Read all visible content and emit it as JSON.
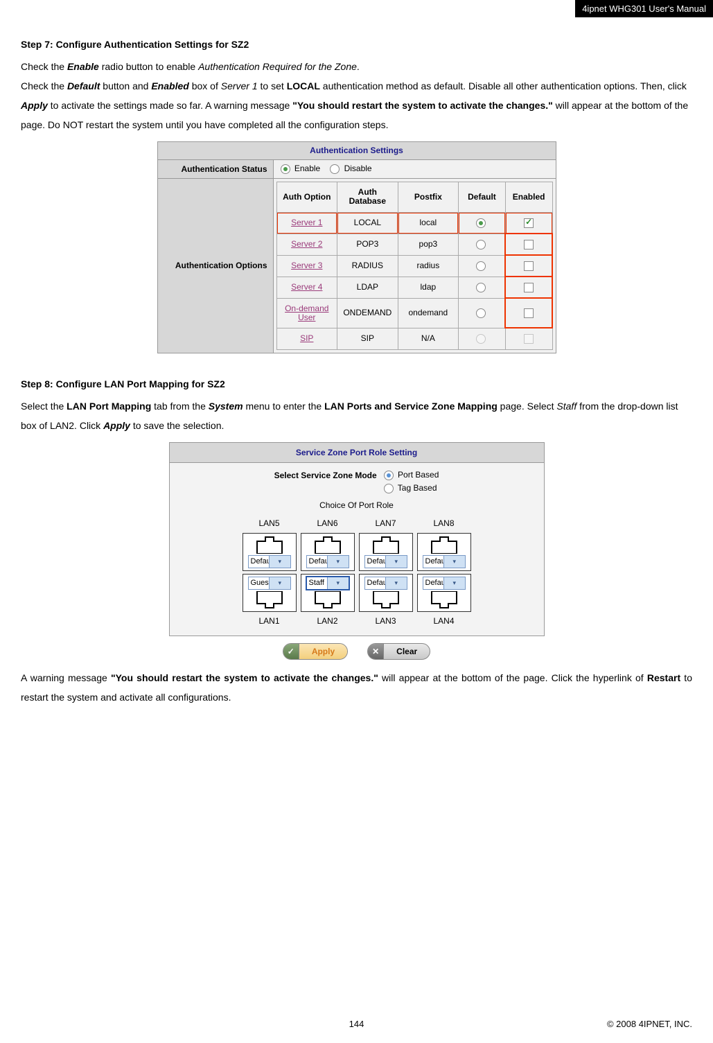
{
  "header": {
    "doc_title": "4ipnet WHG301 User's Manual"
  },
  "step7": {
    "title": "Step 7: Configure Authentication Settings for SZ2",
    "para": {
      "p1a": "Check the ",
      "enable": "Enable",
      "p1b": " radio button to enable ",
      "authreq": "Authentication Required for the Zone",
      "p1c": ".",
      "p2a": "Check the ",
      "default": "Default",
      "p2b": " button and ",
      "enabled": "Enabled",
      "p2c": " box of ",
      "server1": "Server 1",
      "p2d": " to set ",
      "local": "LOCAL",
      "p2e": " authentication method as default. Disable all other authentication options. Then, click ",
      "apply": "Apply",
      "p2f": " to activate the settings made so far. A warning message ",
      "warn": "\"You should restart the system to activate the changes.\"",
      "p2g": " will appear at the bottom of the page. Do NOT restart the system until you have completed all the configuration steps."
    }
  },
  "auth_settings": {
    "title": "Authentication Settings",
    "row_status_label": "Authentication Status",
    "enable_label": "Enable",
    "disable_label": "Disable",
    "row_options_label": "Authentication Options",
    "cols": {
      "c1": "Auth Option",
      "c2": "Auth Database",
      "c3": "Postfix",
      "c4": "Default",
      "c5": "Enabled"
    },
    "rows": [
      {
        "opt": "Server 1",
        "db": "LOCAL",
        "pf": "local",
        "def": true,
        "en": true,
        "highlight": true
      },
      {
        "opt": "Server 2",
        "db": "POP3",
        "pf": "pop3",
        "def": false,
        "en": false,
        "highlight": false
      },
      {
        "opt": "Server 3",
        "db": "RADIUS",
        "pf": "radius",
        "def": false,
        "en": false,
        "highlight": false
      },
      {
        "opt": "Server 4",
        "db": "LDAP",
        "pf": "ldap",
        "def": false,
        "en": false,
        "highlight": false
      },
      {
        "opt": "On-demand User",
        "db": "ONDEMAND",
        "pf": "ondemand",
        "def": false,
        "en": false,
        "highlight": false
      },
      {
        "opt": "SIP",
        "db": "SIP",
        "pf": "N/A",
        "def": "na",
        "en": "na",
        "highlight": false
      }
    ]
  },
  "step8": {
    "title": "Step 8: Configure LAN Port Mapping for SZ2",
    "p1a": "Select the ",
    "lpm": "LAN Port Mapping",
    "p1b": " tab from the ",
    "system": "System",
    "p1c": " menu to enter the ",
    "lpszm": "LAN Ports and Service Zone Mapping",
    "p1d": " page. Select ",
    "staff": "Staff",
    "p1e": " from the drop-down list box of LAN2. Click ",
    "apply": "Apply",
    "p1f": " to save the selection."
  },
  "port_setting": {
    "title": "Service Zone Port Role Setting",
    "mode_label": "Select Service Zone Mode",
    "mode_opts": {
      "a": "Port Based",
      "b": "Tag Based"
    },
    "choice_label": "Choice Of Port Role",
    "top_labels": {
      "l5": "LAN5",
      "l6": "LAN6",
      "l7": "LAN7",
      "l8": "LAN8"
    },
    "bottom_labels": {
      "l1": "LAN1",
      "l2": "LAN2",
      "l3": "LAN3",
      "l4": "LAN4"
    },
    "top_vals": {
      "v5": "Default",
      "v6": "Default",
      "v7": "Default",
      "v8": "Default"
    },
    "bottom_vals": {
      "v1": "Guest",
      "v2": "Staff",
      "v3": "Default",
      "v4": "Default"
    },
    "buttons": {
      "apply": "Apply",
      "clear": "Clear"
    }
  },
  "tail": {
    "p1a": "A warning message ",
    "warn": "\"You should restart the system to activate the changes.\"",
    "p1b": " will appear at the bottom of the page. Click the hyperlink of ",
    "restart": "Restart",
    "p1c": " to restart the system and activate all configurations."
  },
  "footer": {
    "page": "144",
    "copyright": "© 2008 4IPNET, INC."
  }
}
